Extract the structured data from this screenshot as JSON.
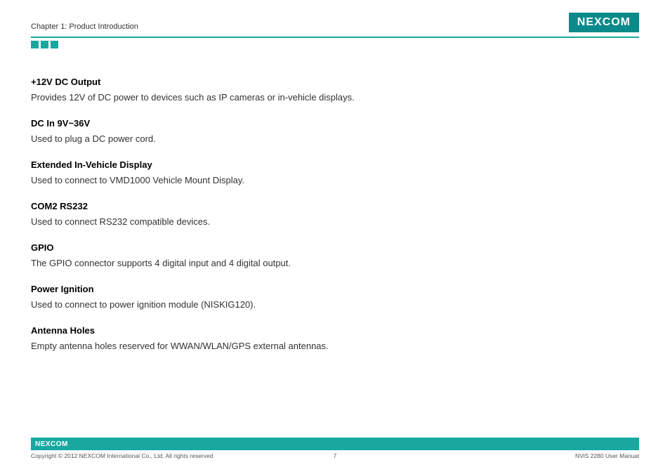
{
  "header": {
    "chapter": "Chapter 1: Product Introduction",
    "logo": "NEXCOM"
  },
  "sections": [
    {
      "title": "+12V DC Output",
      "desc": "Provides 12V of DC power to devices such as IP cameras or in-vehicle displays."
    },
    {
      "title": "DC In 9V~36V",
      "desc": "Used to plug a DC power cord."
    },
    {
      "title": "Extended In-Vehicle Display",
      "desc": "Used to connect to VMD1000 Vehicle Mount Display."
    },
    {
      "title": "COM2 RS232",
      "desc": "Used to connect RS232 compatible devices."
    },
    {
      "title": "GPIO",
      "desc": "The GPIO connector supports 4 digital input and 4 digital output."
    },
    {
      "title": "Power Ignition",
      "desc": "Used to connect to power ignition module (NISKIG120)."
    },
    {
      "title": "Antenna Holes",
      "desc": "Empty antenna holes reserved for WWAN/WLAN/GPS external antennas."
    }
  ],
  "footer": {
    "logo": "NEXCOM",
    "copyright": "Copyright © 2012 NEXCOM International Co., Ltd. All rights reserved",
    "page": "7",
    "manual": "NViS 2280 User Manual"
  }
}
